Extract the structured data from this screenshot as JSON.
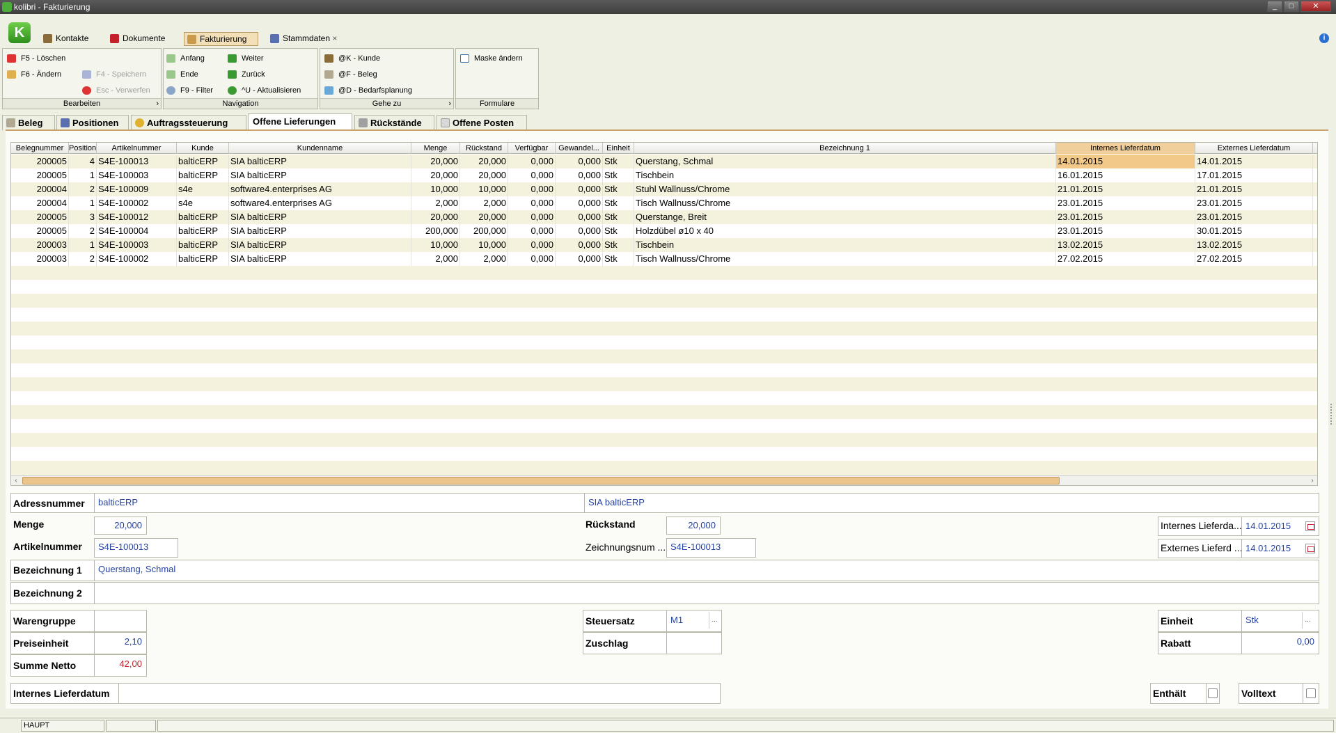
{
  "window": {
    "title": "kolibri - Fakturierung",
    "buttons": [
      "_",
      "□",
      "✕"
    ]
  },
  "menu_tabs": [
    {
      "label": "Kontakte",
      "icon": "contacts-icon",
      "color": "#8a6b3a"
    },
    {
      "label": "Dokumente",
      "icon": "document-icon",
      "color": "#c2202a"
    },
    {
      "label": "Fakturierung",
      "icon": "invoice-icon",
      "color": "#c99a4a",
      "active": true
    },
    {
      "label": "Stammdaten",
      "icon": "masterdata-icon",
      "color": "#5a6fb0",
      "closable": true
    }
  ],
  "close_mark": "×",
  "info_label": "i",
  "ribbon": {
    "bearbeiten": {
      "label": "Bearbeiten",
      "items": [
        {
          "label": "F5 - Löschen",
          "icon": "delete-icon",
          "enabled": true
        },
        {
          "label": "F6 - Ändern",
          "icon": "edit-icon",
          "enabled": true
        },
        {
          "label": "F4 - Speichern",
          "icon": "save-icon",
          "enabled": false
        },
        {
          "label": "Esc - Verwerfen",
          "icon": "discard-icon",
          "enabled": false
        }
      ]
    },
    "navigation": {
      "label": "Navigation",
      "items": [
        {
          "label": "Anfang",
          "icon": "first-icon"
        },
        {
          "label": "Weiter",
          "icon": "next-icon"
        },
        {
          "label": "Ende",
          "icon": "last-icon"
        },
        {
          "label": "Zurück",
          "icon": "back-icon"
        },
        {
          "label": "F9 - Filter",
          "icon": "filter-icon"
        },
        {
          "label": "^U - Aktualisieren",
          "icon": "refresh-icon"
        }
      ]
    },
    "gehezu": {
      "label": "Gehe zu",
      "items": [
        {
          "label": "@K - Kunde",
          "icon": "customer-icon"
        },
        {
          "label": "@F - Beleg",
          "icon": "receipt-icon"
        },
        {
          "label": "@D - Bedarfsplanung",
          "icon": "planning-icon"
        }
      ]
    },
    "formulare": {
      "label": "Formulare",
      "items": [
        {
          "label": "Maske ändern",
          "icon": "mask-icon"
        }
      ]
    },
    "expand_mark": "›"
  },
  "tabs": [
    {
      "label": "Beleg",
      "icon": "receipt-icon"
    },
    {
      "label": "Positionen",
      "icon": "positions-icon"
    },
    {
      "label": "Auftragssteuerung",
      "icon": "order-icon"
    },
    {
      "label": "Offene Lieferungen",
      "icon": "",
      "active": true
    },
    {
      "label": "Rückstände",
      "icon": "backlog-icon"
    },
    {
      "label": "Offene Posten",
      "icon": "open-items-icon"
    }
  ],
  "grid": {
    "columns": [
      "Belegnummer",
      "Position",
      "Artikelnummer",
      "Kunde",
      "Kundenname",
      "Menge",
      "Rückstand",
      "Verfügbar",
      "Gewandel...",
      "Einheit",
      "Bezeichnung 1",
      "Internes Lieferdatum",
      "Externes Lieferdatum"
    ],
    "rows": [
      [
        "200005",
        "4",
        "S4E-100013",
        "balticERP",
        "SIA balticERP",
        "20,000",
        "20,000",
        "0,000",
        "0,000",
        "Stk",
        "Querstang, Schmal",
        "14.01.2015",
        "14.01.2015"
      ],
      [
        "200005",
        "1",
        "S4E-100003",
        "balticERP",
        "SIA balticERP",
        "20,000",
        "20,000",
        "0,000",
        "0,000",
        "Stk",
        "Tischbein",
        "16.01.2015",
        "17.01.2015"
      ],
      [
        "200004",
        "2",
        "S4E-100009",
        "s4e",
        "software4.enterprises AG",
        "10,000",
        "10,000",
        "0,000",
        "0,000",
        "Stk",
        "Stuhl Wallnuss/Chrome",
        "21.01.2015",
        "21.01.2015"
      ],
      [
        "200004",
        "1",
        "S4E-100002",
        "s4e",
        "software4.enterprises AG",
        "2,000",
        "2,000",
        "0,000",
        "0,000",
        "Stk",
        "Tisch Wallnuss/Chrome",
        "23.01.2015",
        "23.01.2015"
      ],
      [
        "200005",
        "3",
        "S4E-100012",
        "balticERP",
        "SIA balticERP",
        "20,000",
        "20,000",
        "0,000",
        "0,000",
        "Stk",
        "Querstange, Breit",
        "23.01.2015",
        "23.01.2015"
      ],
      [
        "200005",
        "2",
        "S4E-100004",
        "balticERP",
        "SIA balticERP",
        "200,000",
        "200,000",
        "0,000",
        "0,000",
        "Stk",
        "Holzdübel ø10 x 40",
        "23.01.2015",
        "30.01.2015"
      ],
      [
        "200003",
        "1",
        "S4E-100003",
        "balticERP",
        "SIA balticERP",
        "10,000",
        "10,000",
        "0,000",
        "0,000",
        "Stk",
        "Tischbein",
        "13.02.2015",
        "13.02.2015"
      ],
      [
        "200003",
        "2",
        "S4E-100002",
        "balticERP",
        "SIA balticERP",
        "2,000",
        "2,000",
        "0,000",
        "0,000",
        "Stk",
        "Tisch Wallnuss/Chrome",
        "27.02.2015",
        "27.02.2015"
      ]
    ],
    "scroll_left": "‹",
    "scroll_right": "›"
  },
  "form": {
    "adressnummer": {
      "label": "Adressnummer",
      "value": "balticERP",
      "name_value": "SIA balticERP"
    },
    "menge": {
      "label": "Menge",
      "value": "20,000"
    },
    "rueckstand": {
      "label": "Rückstand",
      "value": "20,000"
    },
    "internes_lieferdatum_short": {
      "label": "Internes Lieferda...",
      "value": "14.01.2015"
    },
    "artikelnummer": {
      "label": "Artikelnummer",
      "value": "S4E-100013"
    },
    "zeichnungsnummer": {
      "label": "Zeichnungsnum ...",
      "value": "S4E-100013"
    },
    "externes_lieferdatum_short": {
      "label": "Externes Lieferd ...",
      "value": "14.01.2015"
    },
    "bezeichnung1": {
      "label": "Bezeichnung 1",
      "value": "Querstang, Schmal"
    },
    "bezeichnung2": {
      "label": "Bezeichnung 2",
      "value": ""
    },
    "warengruppe": {
      "label": "Warengruppe",
      "value": ""
    },
    "steuersatz": {
      "label": "Steuersatz",
      "value": "M1"
    },
    "einheit": {
      "label": "Einheit",
      "value": "Stk"
    },
    "preiseinheit": {
      "label": "Preiseinheit",
      "value": "2,10"
    },
    "zuschlag": {
      "label": "Zuschlag",
      "value": ""
    },
    "rabatt": {
      "label": "Rabatt",
      "value": "0,00"
    },
    "summe_netto": {
      "label": "Summe Netto",
      "value": "42,00"
    },
    "internes_lieferdatum": {
      "label": "Internes Lieferdatum",
      "value": ""
    },
    "enthaelt": {
      "label": "Enthält",
      "checked": false
    },
    "volltext": {
      "label": "Volltext",
      "checked": false
    },
    "dots": "..."
  },
  "statusbar": {
    "mode": "HAUPT"
  }
}
